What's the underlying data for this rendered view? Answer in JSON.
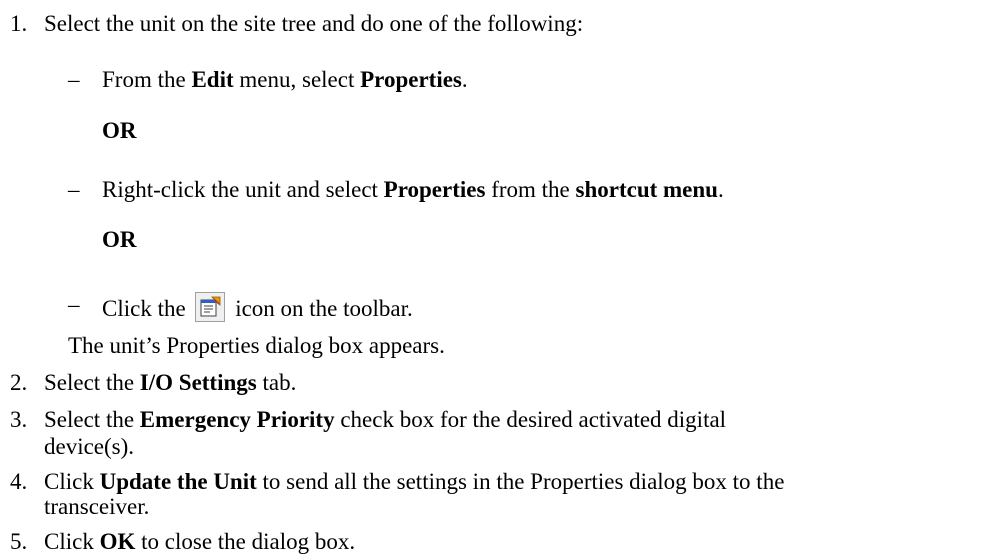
{
  "step1": {
    "num": "1.",
    "text": "Select the unit on the site tree and do one of the following:",
    "opt1": {
      "dash": "–",
      "pre": "From the ",
      "b1": "Edit",
      "mid": " menu, select ",
      "b2": "Properties",
      "post": "."
    },
    "or1": "OR",
    "opt2": {
      "dash": "–",
      "pre": "Right-click the unit and select ",
      "b1": "Properties",
      "mid": " from the ",
      "b2": "shortcut menu",
      "post": "."
    },
    "or2": "OR",
    "opt3": {
      "dash": "–",
      "pre": "Click the",
      "icon": "properties-icon",
      "post": "icon on the toolbar."
    },
    "result": "The unit’s Properties dialog box appears."
  },
  "step2": {
    "num": "2.",
    "pre": "Select the ",
    "b": "I/O Settings",
    "post": " tab."
  },
  "step3": {
    "num": "3.",
    "pre": "Select the ",
    "b": "Emergency Priority",
    "post": " check box for the desired activated digital",
    "cont": "device(s)."
  },
  "step4": {
    "num": "4.",
    "pre": "Click ",
    "b": "Update the Unit",
    "post": " to send all the settings in the Properties dialog box to the",
    "cont": "transceiver."
  },
  "step5": {
    "num": "5.",
    "pre": "Click ",
    "b": "OK",
    "post": " to close the dialog box."
  }
}
